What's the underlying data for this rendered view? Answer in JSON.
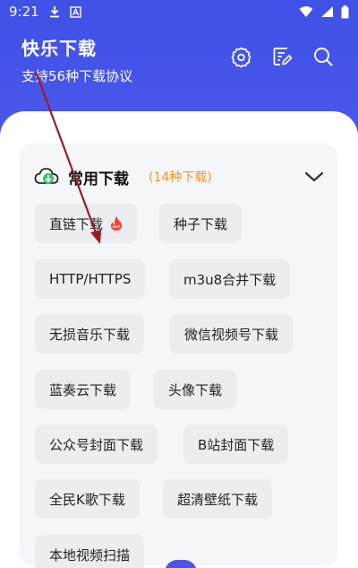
{
  "status_bar": {
    "time": "9:21",
    "icons": [
      "download-icon",
      "text-icon",
      "wifi-icon",
      "signal-icon",
      "battery-icon"
    ]
  },
  "header": {
    "title": "快乐下载",
    "subtitle": "支持56种下载协议",
    "actions": [
      "settings-icon",
      "note-icon",
      "search-icon"
    ]
  },
  "section": {
    "title": "常用下载",
    "count": "(14种下载)"
  },
  "chips": [
    "直链下载",
    "种子下载",
    "HTTP/HTTPS",
    "m3u8合并下载",
    "无损音乐下载",
    "微信视频号下载",
    "蓝奏云下载",
    "头像下载",
    "公众号封面下载",
    "B站封面下载",
    "全民K歌下载",
    "超清壁纸下载",
    "本地视频扫描"
  ],
  "colors": {
    "header_blue": "#3f51e6",
    "count_orange": "#f29a1e",
    "hot_red": "#e84a3a",
    "annotation_red": "#9b1d23"
  }
}
